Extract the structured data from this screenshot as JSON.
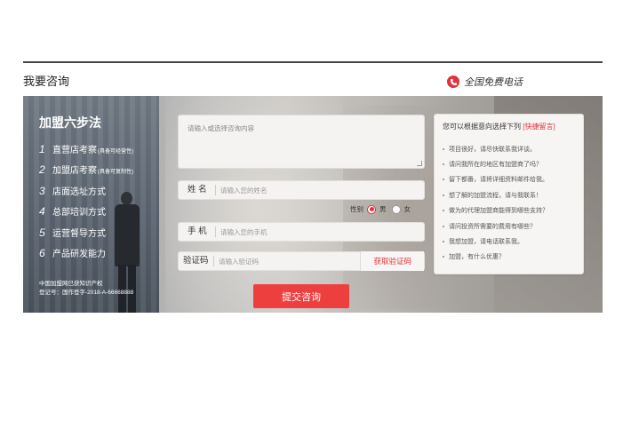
{
  "section": {
    "title": "我要咨询"
  },
  "hotline": {
    "label": "全国免费电话",
    "icon": "phone-icon",
    "color": "#e0333c"
  },
  "steps_panel": {
    "title": "加盟六步法",
    "steps": [
      {
        "num": "1",
        "label": "直营店考察",
        "note": "(具备可经营性)"
      },
      {
        "num": "2",
        "label": "加盟店考察",
        "note": "(具备可复制性)"
      },
      {
        "num": "3",
        "label": "店面选址方式",
        "note": ""
      },
      {
        "num": "4",
        "label": "总部培训方式",
        "note": ""
      },
      {
        "num": "5",
        "label": "运营督导方式",
        "note": ""
      },
      {
        "num": "6",
        "label": "产品研发能力",
        "note": ""
      }
    ],
    "footer_line1": "中国加盟网已获知识产权",
    "footer_line2": "登记号：国作登字-2018-A-66668888"
  },
  "form": {
    "textarea_placeholder": "请输入或选择咨询内容",
    "name": {
      "label": "姓  名",
      "placeholder": "请输入您的姓名"
    },
    "gender": {
      "label": "性别",
      "options": [
        "男",
        "女"
      ],
      "selected": "男"
    },
    "phone": {
      "label": "手  机",
      "placeholder": "请输入您的手机"
    },
    "code": {
      "label": "验证码",
      "placeholder": "请输入验证码",
      "action": "获取验证码"
    },
    "submit": "提交咨询"
  },
  "quick": {
    "head": "您可以根据意向选择下列",
    "head_link": "[快捷留言]",
    "items": [
      "项目很好，请尽快联系我详谈。",
      "请问我所在的地区有加盟商了吗？",
      "留下都番，请将详细资料邮件给我。",
      "想了解的加盟流程，请与我联系！",
      "做为的代理加盟商能得到哪些支持？",
      "请问投资所需要的费用有哪些？",
      "我想加盟，请电话联系我。",
      "加盟，有什么优惠？"
    ]
  },
  "colors": {
    "accent": "#e0333c",
    "submit": "#ee3f3f"
  }
}
